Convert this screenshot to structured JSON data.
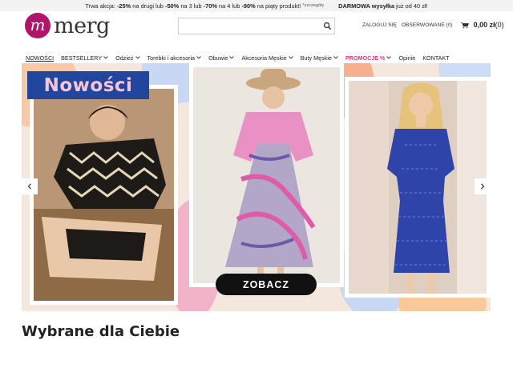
{
  "promo": {
    "pre": "Trwa akcja:",
    "d1": "-25%",
    "t1": "na drugi lub",
    "d2": "-50%",
    "t2": "na 3 lub",
    "d3": "-70%",
    "t3": "na 4 lub",
    "d4": "-90%",
    "t4": "na piąty produkt!",
    "details": "*szczegóły",
    "shipping_bold": "DARMOWA wysyłka",
    "shipping_rest": "już od 40 zł!"
  },
  "brand": {
    "logo_letter": "m",
    "name": "merg",
    "color": "#b0156b"
  },
  "search": {
    "placeholder": "",
    "value": "",
    "icon": "search-icon"
  },
  "header": {
    "login": "ZALOGUJ SIĘ",
    "watched": "OBSERWOWANE (0)",
    "cart_price": "0,00 zł",
    "cart_count": "(0)",
    "cart_icon": "cart-icon"
  },
  "nav": {
    "items": [
      {
        "label": "NOWOŚCI"
      },
      {
        "label": "BESTSELLERY"
      },
      {
        "label": "Odzież"
      },
      {
        "label": "Torebki i akcesoria"
      },
      {
        "label": "Obuwie"
      },
      {
        "label": "Akcesoria Męskie"
      },
      {
        "label": "Buty Męskie"
      },
      {
        "label": "PROMOCJE %"
      },
      {
        "label": "Opinie"
      },
      {
        "label": "KONTAKT"
      }
    ],
    "promo_color": "#e0367a"
  },
  "banner": {
    "headline": "Nowości",
    "cta": "ZOBACZ",
    "headline_bg": "#22469e",
    "headline_color": "#f7c5d8",
    "prev_icon": "chevron-left-icon",
    "next_icon": "chevron-right-icon"
  },
  "section": {
    "title": "Wybrane dla Ciebie"
  }
}
